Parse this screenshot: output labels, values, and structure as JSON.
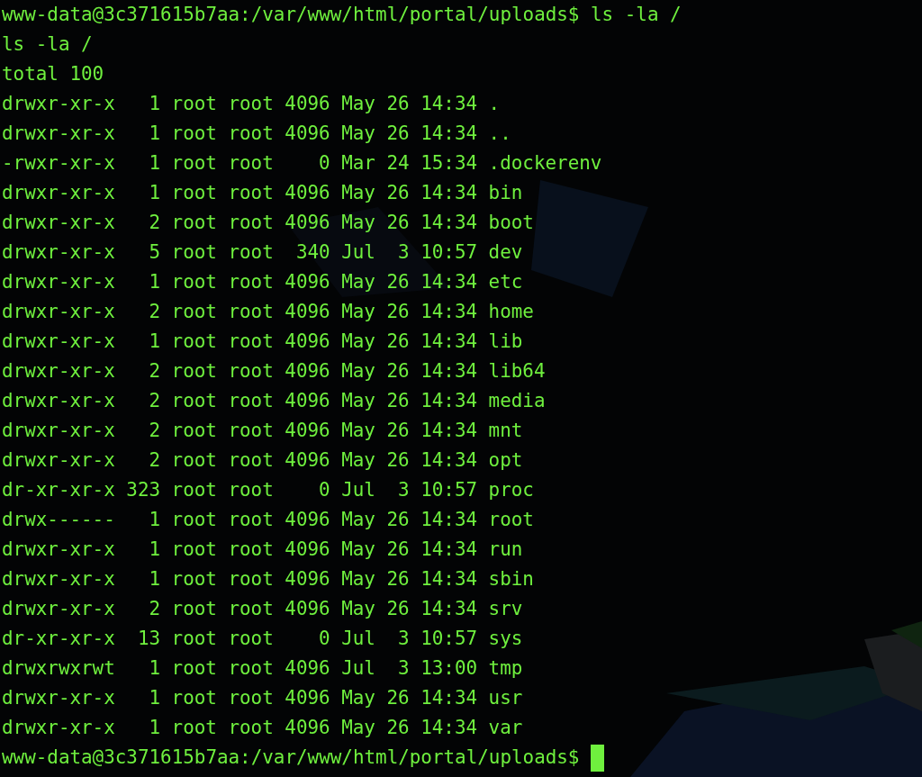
{
  "terminal": {
    "command_prompt": "www-data@3c371615b7aa:/var/www/html/portal/uploads$",
    "command": "ls -la /",
    "echo": "ls -la /",
    "total": "total 100",
    "entries": [
      {
        "permissions": "drwxr-xr-x",
        "links": "1",
        "owner": "root",
        "group": "root",
        "size": "4096",
        "month": "May",
        "day": "26",
        "time": "14:34",
        "name": "."
      },
      {
        "permissions": "drwxr-xr-x",
        "links": "1",
        "owner": "root",
        "group": "root",
        "size": "4096",
        "month": "May",
        "day": "26",
        "time": "14:34",
        "name": ".."
      },
      {
        "permissions": "-rwxr-xr-x",
        "links": "1",
        "owner": "root",
        "group": "root",
        "size": "0",
        "month": "Mar",
        "day": "24",
        "time": "15:34",
        "name": ".dockerenv"
      },
      {
        "permissions": "drwxr-xr-x",
        "links": "1",
        "owner": "root",
        "group": "root",
        "size": "4096",
        "month": "May",
        "day": "26",
        "time": "14:34",
        "name": "bin"
      },
      {
        "permissions": "drwxr-xr-x",
        "links": "2",
        "owner": "root",
        "group": "root",
        "size": "4096",
        "month": "May",
        "day": "26",
        "time": "14:34",
        "name": "boot"
      },
      {
        "permissions": "drwxr-xr-x",
        "links": "5",
        "owner": "root",
        "group": "root",
        "size": "340",
        "month": "Jul",
        "day": "3",
        "time": "10:57",
        "name": "dev"
      },
      {
        "permissions": "drwxr-xr-x",
        "links": "1",
        "owner": "root",
        "group": "root",
        "size": "4096",
        "month": "May",
        "day": "26",
        "time": "14:34",
        "name": "etc"
      },
      {
        "permissions": "drwxr-xr-x",
        "links": "2",
        "owner": "root",
        "group": "root",
        "size": "4096",
        "month": "May",
        "day": "26",
        "time": "14:34",
        "name": "home"
      },
      {
        "permissions": "drwxr-xr-x",
        "links": "1",
        "owner": "root",
        "group": "root",
        "size": "4096",
        "month": "May",
        "day": "26",
        "time": "14:34",
        "name": "lib"
      },
      {
        "permissions": "drwxr-xr-x",
        "links": "2",
        "owner": "root",
        "group": "root",
        "size": "4096",
        "month": "May",
        "day": "26",
        "time": "14:34",
        "name": "lib64"
      },
      {
        "permissions": "drwxr-xr-x",
        "links": "2",
        "owner": "root",
        "group": "root",
        "size": "4096",
        "month": "May",
        "day": "26",
        "time": "14:34",
        "name": "media"
      },
      {
        "permissions": "drwxr-xr-x",
        "links": "2",
        "owner": "root",
        "group": "root",
        "size": "4096",
        "month": "May",
        "day": "26",
        "time": "14:34",
        "name": "mnt"
      },
      {
        "permissions": "drwxr-xr-x",
        "links": "2",
        "owner": "root",
        "group": "root",
        "size": "4096",
        "month": "May",
        "day": "26",
        "time": "14:34",
        "name": "opt"
      },
      {
        "permissions": "dr-xr-xr-x",
        "links": "323",
        "owner": "root",
        "group": "root",
        "size": "0",
        "month": "Jul",
        "day": "3",
        "time": "10:57",
        "name": "proc"
      },
      {
        "permissions": "drwx------",
        "links": "1",
        "owner": "root",
        "group": "root",
        "size": "4096",
        "month": "May",
        "day": "26",
        "time": "14:34",
        "name": "root"
      },
      {
        "permissions": "drwxr-xr-x",
        "links": "1",
        "owner": "root",
        "group": "root",
        "size": "4096",
        "month": "May",
        "day": "26",
        "time": "14:34",
        "name": "run"
      },
      {
        "permissions": "drwxr-xr-x",
        "links": "1",
        "owner": "root",
        "group": "root",
        "size": "4096",
        "month": "May",
        "day": "26",
        "time": "14:34",
        "name": "sbin"
      },
      {
        "permissions": "drwxr-xr-x",
        "links": "2",
        "owner": "root",
        "group": "root",
        "size": "4096",
        "month": "May",
        "day": "26",
        "time": "14:34",
        "name": "srv"
      },
      {
        "permissions": "dr-xr-xr-x",
        "links": "13",
        "owner": "root",
        "group": "root",
        "size": "0",
        "month": "Jul",
        "day": "3",
        "time": "10:57",
        "name": "sys"
      },
      {
        "permissions": "drwxrwxrwt",
        "links": "1",
        "owner": "root",
        "group": "root",
        "size": "4096",
        "month": "Jul",
        "day": "3",
        "time": "13:00",
        "name": "tmp"
      },
      {
        "permissions": "drwxr-xr-x",
        "links": "1",
        "owner": "root",
        "group": "root",
        "size": "4096",
        "month": "May",
        "day": "26",
        "time": "14:34",
        "name": "usr"
      },
      {
        "permissions": "drwxr-xr-x",
        "links": "1",
        "owner": "root",
        "group": "root",
        "size": "4096",
        "month": "May",
        "day": "26",
        "time": "14:34",
        "name": "var"
      }
    ],
    "final_prompt": "www-data@3c371615b7aa:/var/www/html/portal/uploads$"
  }
}
